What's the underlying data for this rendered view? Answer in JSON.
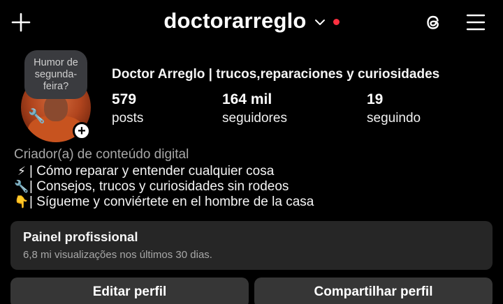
{
  "header": {
    "username": "doctorarreglo",
    "icons": [
      "plus-icon",
      "chevron-down-icon",
      "threads-icon",
      "hamburger-menu-icon"
    ],
    "notification_dot_color": "#ff3040"
  },
  "profile": {
    "note": "Humor de segunda-feira?",
    "full_name": "Doctor Arreglo | trucos,reparaciones y curiosidades",
    "stats": [
      {
        "value": "579",
        "label": "posts"
      },
      {
        "value": "164 mil",
        "label": "seguidores"
      },
      {
        "value": "19",
        "label": "seguindo"
      }
    ],
    "category": "Criador(a) de conteúdo digital",
    "bio": [
      {
        "emoji": "⚡",
        "text": "| Cómo reparar y entender cualquier cosa"
      },
      {
        "emoji": "🔧",
        "text": "| Consejos, trucos y curiosidades sin rodeos"
      },
      {
        "emoji": "👇",
        "text": "| Sígueme y conviértete en el hombre de la casa"
      }
    ]
  },
  "dashboard": {
    "title": "Painel profissional",
    "subtitle": "6,8 mi visualizações nos últimos 30 dias."
  },
  "actions": {
    "edit": "Editar perfil",
    "share": "Compartilhar perfil"
  }
}
